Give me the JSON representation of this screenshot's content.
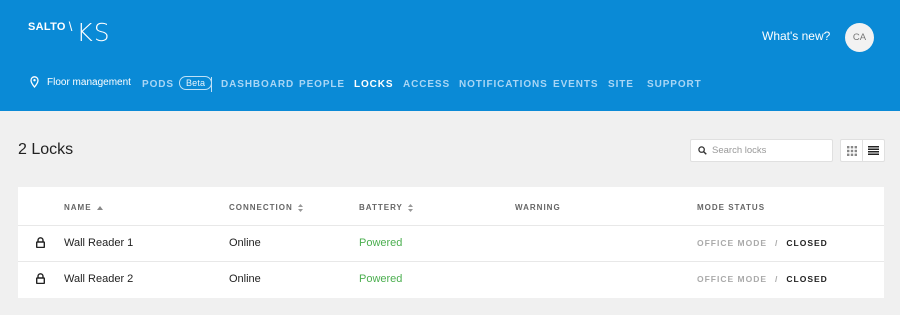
{
  "brand": {
    "salto": "SALTO",
    "slash": "\\",
    "ks": "KS"
  },
  "header": {
    "whats_new": "What's new?",
    "avatar_initials": "CA"
  },
  "nav": {
    "floor": "Floor management",
    "pods": "PODS",
    "beta": "Beta",
    "items": [
      {
        "label": "DASHBOARD",
        "active": false
      },
      {
        "label": "PEOPLE",
        "active": false
      },
      {
        "label": "LOCKS",
        "active": true
      },
      {
        "label": "ACCESS",
        "active": false
      },
      {
        "label": "NOTIFICATIONS",
        "active": false
      },
      {
        "label": "EVENTS",
        "active": false
      },
      {
        "label": "SITE",
        "active": false
      },
      {
        "label": "SUPPORT",
        "active": false
      }
    ]
  },
  "page": {
    "title": "2 Locks",
    "search_placeholder": "Search locks"
  },
  "table": {
    "columns": [
      "NAME",
      "CONNECTION",
      "BATTERY",
      "WARNING",
      "MODE STATUS"
    ],
    "rows": [
      {
        "name": "Wall Reader 1",
        "connection": "Online",
        "battery": "Powered",
        "warning": "",
        "mode_off": "OFFICE MODE",
        "mode_sep": "/",
        "mode_on": "CLOSED"
      },
      {
        "name": "Wall Reader 2",
        "connection": "Online",
        "battery": "Powered",
        "warning": "",
        "mode_off": "OFFICE MODE",
        "mode_sep": "/",
        "mode_on": "CLOSED"
      }
    ]
  },
  "colors": {
    "header_bg": "#0a8ad6",
    "nav_inactive": "#a9d6f5",
    "battery_ok": "#4caf50"
  },
  "icons": [
    "location-pin-icon",
    "search-icon",
    "grid-view-icon",
    "list-view-icon",
    "lock-icon",
    "sort-asc-icon",
    "sort-icon"
  ]
}
